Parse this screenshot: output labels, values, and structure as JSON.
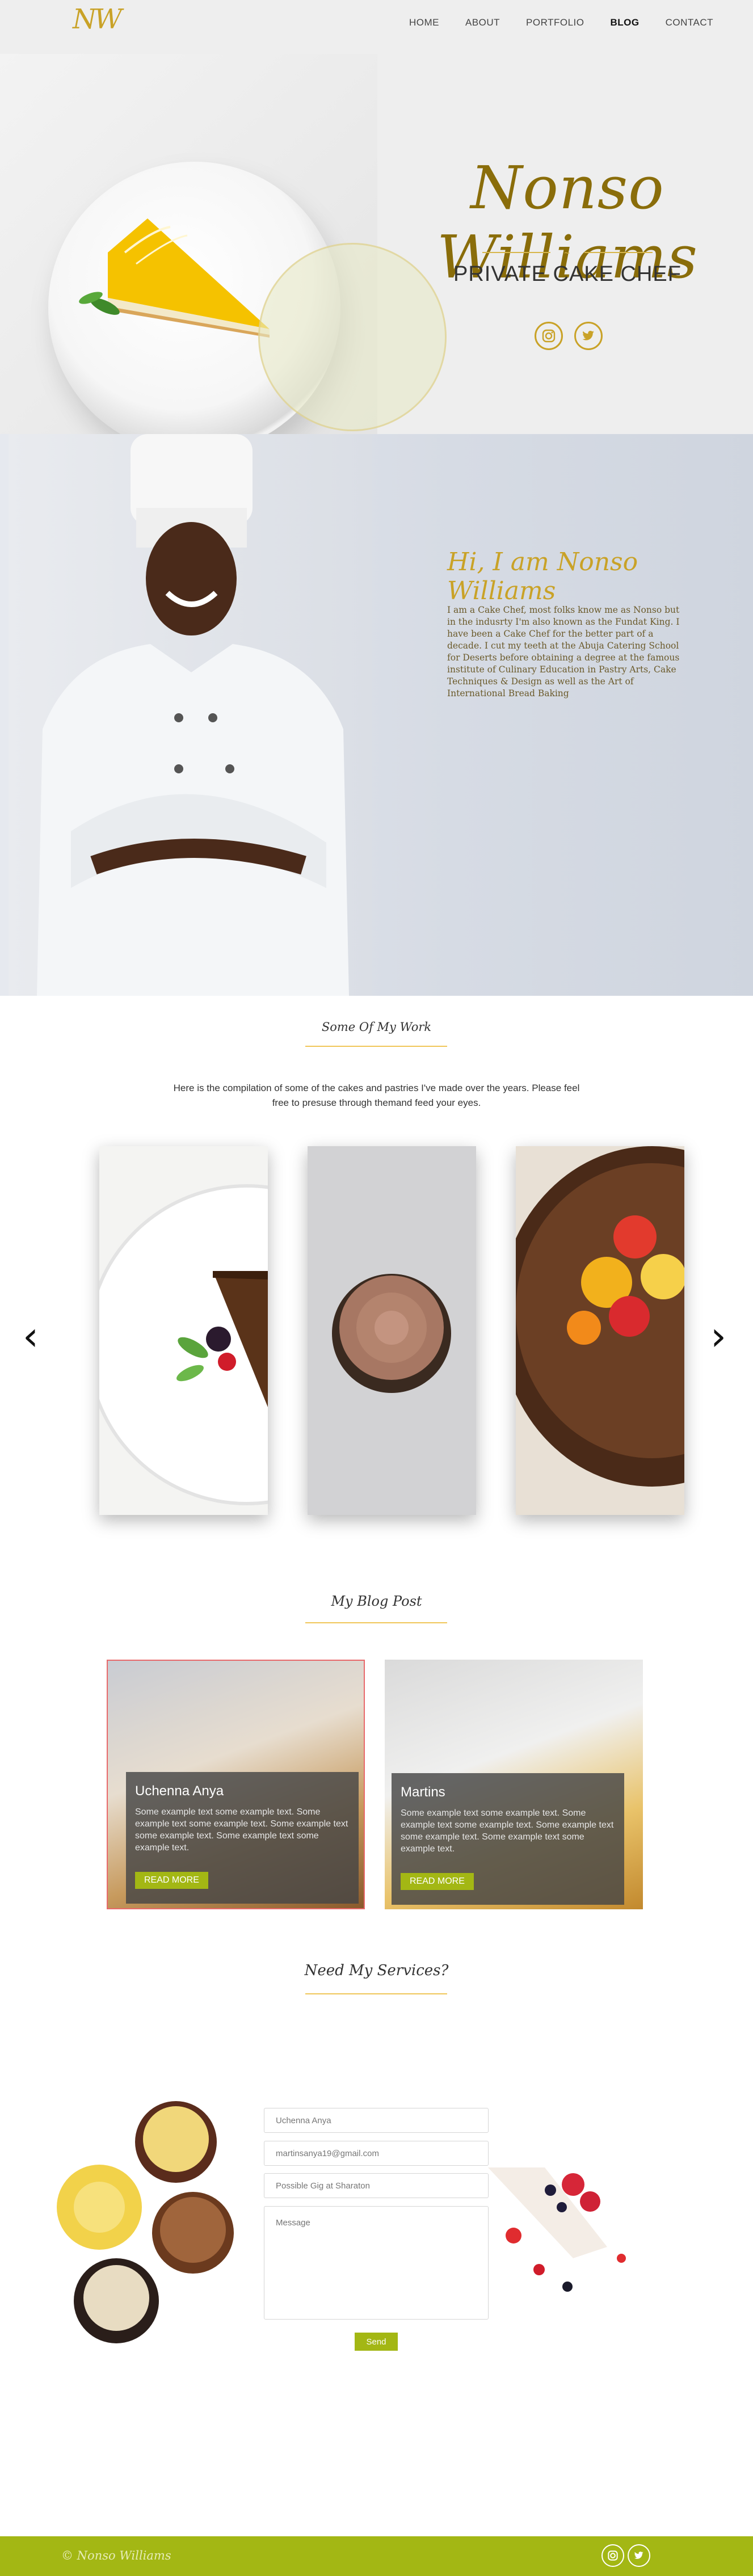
{
  "nav": {
    "logo": "NW",
    "links": [
      "HOME",
      "ABOUT",
      "PORTFOLIO",
      "BLOG",
      "CONTACT"
    ],
    "active": "BLOG"
  },
  "hero": {
    "name": "Nonso Williams",
    "subtitle": "PRIVATE CAKE CHEF",
    "divider_glyph": "~",
    "icons": [
      "instagram-icon",
      "twitter-icon"
    ]
  },
  "about": {
    "title": "Hi, I am Nonso Williams",
    "text": "I am a Cake Chef, most folks know me as Nonso but in the indusrty I'm also known as the Fundat King. I have been a Cake Chef for the better part of a decade. I cut my teeth at the Abuja Catering School for Deserts before obtaining a degree at the famous institute of Culinary Education in Pastry Arts, Cake Techniques & Design as well as the Art of International Bread Baking"
  },
  "work": {
    "title": "Some Of My Work",
    "intro": "Here is the compilation of some of the cakes and pastries I've made over the years. Please feel free to presuse through themand feed your eyes.",
    "prev": "‹",
    "next": "›"
  },
  "blog": {
    "title": "My Blog Post",
    "posts": [
      {
        "name": "Uchenna Anya",
        "text": "Some example text some example text. Some example text some example text. Some example text some example text. Some example text some example text.",
        "button": "READ MORE"
      },
      {
        "name": "Martins",
        "text": "Some example text some example text. Some example text some example text. Some example text some example text. Some example text some example text.",
        "button": "READ MORE"
      }
    ]
  },
  "services": {
    "title": "Need My Services?",
    "name_value": "Uchenna Anya",
    "email_value": "martinsanya19@gmail.com",
    "subject_value": "Possible Gig at Sharaton",
    "message_placeholder": "Message",
    "send": "Send"
  },
  "footer": {
    "copy": "© Nonso Williams"
  },
  "colors": {
    "gold": "#c9a227",
    "accent_green": "#a3b714",
    "heading_brown": "#8a6d0a"
  }
}
